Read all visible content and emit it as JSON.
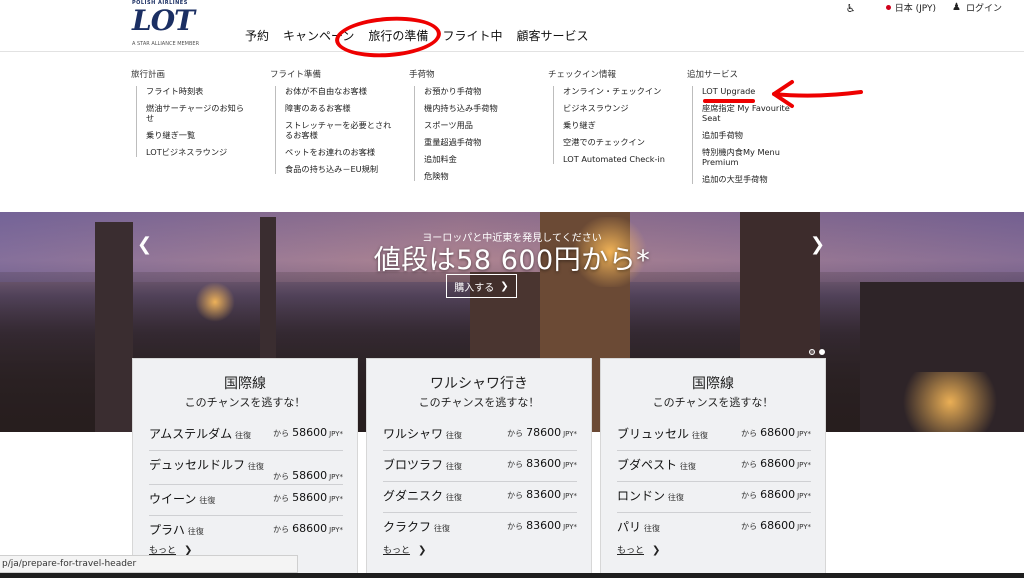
{
  "brand": {
    "tagline": "POLISH AIRLINES",
    "logo_text": "LOT",
    "alliance": "A STAR ALLIANCE MEMBER"
  },
  "header": {
    "nav": [
      "予約",
      "キャンペーン",
      "旅行の準備",
      "フライト中",
      "顧客サービス"
    ],
    "language": "日本 (JPY)",
    "login": "ログイン"
  },
  "mega_menu": {
    "columns": [
      {
        "title": "旅行計画",
        "items": [
          "フライト時刻表",
          "燃油サーチャージのお知らせ",
          "乗り継ぎ一覧",
          "LOTビジネスラウンジ"
        ]
      },
      {
        "title": "フライト準備",
        "items": [
          "お体が不自由なお客様",
          "障害のあるお客様",
          "ストレッチャーを必要とされるお客様",
          "ペットをお連れのお客様",
          "食品の持ち込み－EU規制"
        ]
      },
      {
        "title": "手荷物",
        "items": [
          "お預かり手荷物",
          "機内持ち込み手荷物",
          "スポーツ用品",
          "重量超過手荷物",
          "追加料金",
          "危険物"
        ]
      },
      {
        "title": "チェックイン情報",
        "items": [
          "オンライン・チェックイン",
          "ビジネスラウンジ",
          "乗り継ぎ",
          "空港でのチェックイン",
          "LOT Automated Check-in"
        ]
      },
      {
        "title": "追加サービス",
        "items": [
          "LOT Upgrade",
          "座席指定 My Favourite Seat",
          "追加手荷物",
          "特別機内食My Menu Premium",
          "追加の大型手荷物"
        ]
      }
    ]
  },
  "hero": {
    "subtitle": "ヨーロッパと中近東を発見してください",
    "title": "値段は58 600円から*",
    "cta": "購入する"
  },
  "cards": [
    {
      "title": "国際線",
      "subtitle": "このチャンスを逃すな！",
      "fares": [
        {
          "city": "アムステルダム",
          "trip": "往復",
          "from": "から",
          "price": "58600",
          "currency": "JPY*"
        },
        {
          "city": "デュッセルドルフ",
          "trip": "往復",
          "from": "から",
          "price": "58600",
          "currency": "JPY*"
        },
        {
          "city": "ウイーン",
          "trip": "往復",
          "from": "から",
          "price": "58600",
          "currency": "JPY*"
        },
        {
          "city": "プラハ",
          "trip": "往復",
          "from": "から",
          "price": "68600",
          "currency": "JPY*"
        }
      ],
      "more": "もっと"
    },
    {
      "title": "ワルシャワ行き",
      "subtitle": "このチャンスを逃すな！",
      "fares": [
        {
          "city": "ワルシャワ",
          "trip": "往復",
          "from": "から",
          "price": "78600",
          "currency": "JPY*"
        },
        {
          "city": "ブロツラフ",
          "trip": "往復",
          "from": "から",
          "price": "83600",
          "currency": "JPY*"
        },
        {
          "city": "グダニスク",
          "trip": "往復",
          "from": "から",
          "price": "83600",
          "currency": "JPY*"
        },
        {
          "city": "クラクフ",
          "trip": "往復",
          "from": "から",
          "price": "83600",
          "currency": "JPY*"
        }
      ],
      "more": "もっと"
    },
    {
      "title": "国際線",
      "subtitle": "このチャンスを逃すな！",
      "fares": [
        {
          "city": "ブリュッセル",
          "trip": "往復",
          "from": "から",
          "price": "68600",
          "currency": "JPY*"
        },
        {
          "city": "ブダペスト",
          "trip": "往復",
          "from": "から",
          "price": "68600",
          "currency": "JPY*"
        },
        {
          "city": "ロンドン",
          "trip": "往復",
          "from": "から",
          "price": "68600",
          "currency": "JPY*"
        },
        {
          "city": "パリ",
          "trip": "往復",
          "from": "から",
          "price": "68600",
          "currency": "JPY*"
        }
      ],
      "more": "もっと"
    }
  ],
  "status_bar": {
    "url": "p/ja/prepare-for-travel-header"
  },
  "colors": {
    "brand_navy": "#1b2f63",
    "annotation_red": "#ee0000",
    "card_bg": "#f0f1f3"
  }
}
